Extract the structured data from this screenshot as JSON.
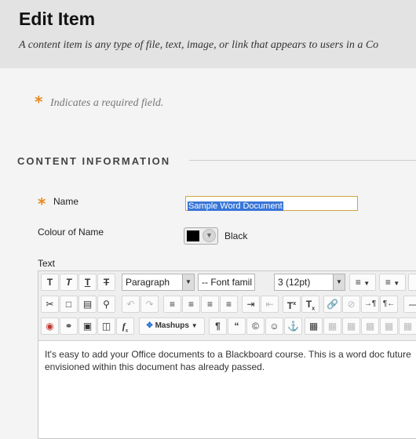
{
  "header": {
    "title": "Edit Item",
    "description": "A content item is any type of file, text, image, or link that appears to users in a Co"
  },
  "required_note": {
    "symbol": "*",
    "text": "Indicates a required field."
  },
  "section": {
    "title": "CONTENT INFORMATION"
  },
  "form": {
    "name_label": "Name",
    "name_value": "Sample Word Document",
    "colour_label": "Colour of Name",
    "colour_value": "Black",
    "colour_hex": "#000000",
    "text_label": "Text"
  },
  "toolbar": {
    "paragraph": "Paragraph",
    "font_family": "-- Font famil",
    "font_size": "3 (12pt)",
    "mashups": "Mashups"
  },
  "editor": {
    "content": "It's easy to add your Office documents to a Blackboard course. This is a word doc future envisioned within this document has already passed."
  },
  "colors": {
    "accent": "#e8891c",
    "selection": "#3875d7",
    "header_bg": "#e3e3e3"
  }
}
